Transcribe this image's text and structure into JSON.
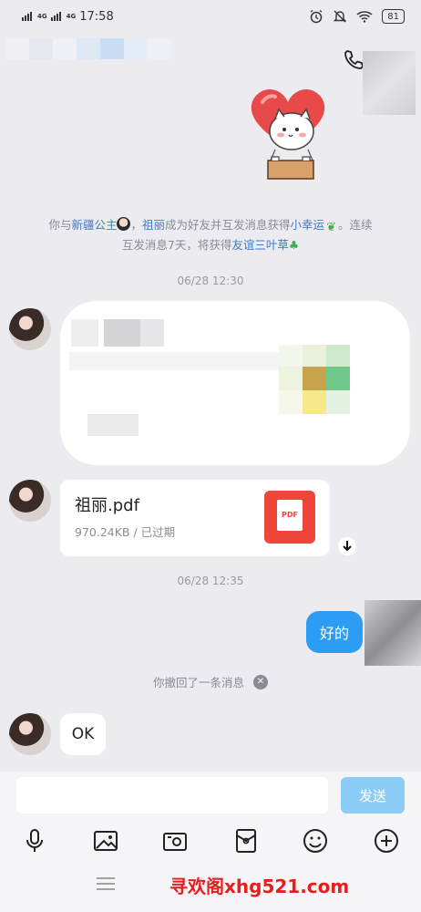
{
  "status_bar": {
    "network_1": "4G",
    "network_2": "4G",
    "time": "17:58",
    "battery": "81"
  },
  "system_notice": {
    "prefix": "你与",
    "friend_a": "新疆公主",
    "separator": "，",
    "friend_b": "祖丽",
    "middle": "成为好友并互发消息获得",
    "reward_1": "小幸运",
    "line_end": "。连续",
    "line2_prefix": "互发消息7天，将获得",
    "reward_2": "友谊三叶草"
  },
  "messages": {
    "timestamp_1": "06/28 12:30",
    "file": {
      "name": "祖丽.pdf",
      "meta": "970.24KB / 已过期",
      "icon_label": "PDF"
    },
    "timestamp_2": "06/28 12:35",
    "sent_text": "好的",
    "recall_note": "你撤回了一条消息",
    "received_ok": "OK"
  },
  "input_bar": {
    "placeholder": "",
    "send_label": "发送"
  },
  "toolbar": {
    "icons": [
      "microphone-icon",
      "image-icon",
      "camera-icon",
      "red-packet-icon",
      "emoji-icon",
      "plus-icon"
    ]
  },
  "watermark": "寻欢阁xhg521.com",
  "colors": {
    "link": "#3f7ac9",
    "sent_bubble": "#2d9cf5",
    "send_button": "#8ccdf7",
    "pdf_red": "#ee4638",
    "watermark": "#e32020"
  }
}
